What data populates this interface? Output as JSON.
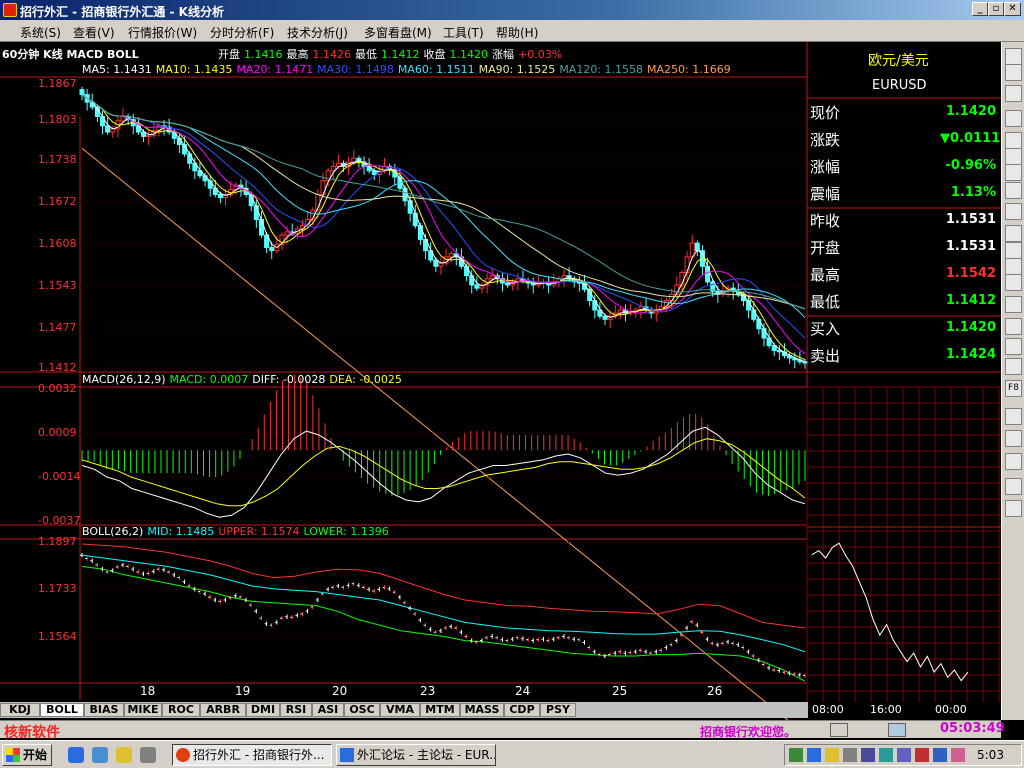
{
  "window": {
    "title": "招行外汇 - 招商银行外汇通 - K线分析"
  },
  "menu": [
    "系统(S)",
    "查看(V)",
    "行情报价(W)",
    "分时分析(F)",
    "技术分析(J)",
    "多窗看盘(M)",
    "工具(T)",
    "帮助(H)"
  ],
  "header": {
    "name": "60分钟 K线 MACD BOLL",
    "quote": [
      {
        "label": "开盘",
        "value": "1.1416"
      },
      {
        "label": "最高",
        "value": "1.1426"
      },
      {
        "label": "最低",
        "value": "1.1412"
      },
      {
        "label": "收盘",
        "value": "1.1420"
      },
      {
        "label": "涨幅",
        "value": "+0.03%"
      }
    ]
  },
  "ma_line": [
    {
      "t": "MA5: 1.1431",
      "c": "#ffffff"
    },
    {
      "t": "MA10: 1.1435",
      "c": "#ffff00"
    },
    {
      "t": "MA20: 1.1471",
      "c": "#ff00ff"
    },
    {
      "t": "MA30: 1.1498",
      "c": "#2f4fff"
    },
    {
      "t": "MA60: 1.1511",
      "c": "#40e0ff"
    },
    {
      "t": "MA90: 1.1525",
      "c": "#e8e8a0"
    },
    {
      "t": "MA120: 1.1558",
      "c": "#4aa0a0"
    },
    {
      "t": "MA250: 1.1669",
      "c": "#ff9a50"
    }
  ],
  "macd": {
    "label": "MACD(26,12,9)",
    "items": [
      {
        "t": "MACD: 0.0007",
        "c": "#00ff00"
      },
      {
        "t": "DIFF: -0.0028",
        "c": "#ffffff"
      },
      {
        "t": "DEA: -0.0025",
        "c": "#ffff00"
      }
    ]
  },
  "boll": {
    "label": "BOLL(26,2)",
    "items": [
      {
        "t": "MID: 1.1485",
        "c": "#00ffff"
      },
      {
        "t": "UPPER: 1.1574",
        "c": "#ff3030"
      },
      {
        "t": "LOWER: 1.1396",
        "c": "#00ff00"
      }
    ]
  },
  "main_axis": [
    "1.1867",
    "1.1803",
    "1.1738",
    "1.1672",
    "1.1608",
    "1.1543",
    "1.1477",
    "1.1412"
  ],
  "macd_axis": [
    "0.0032",
    "0.0009",
    "-0.0014",
    "-0.0037"
  ],
  "boll_axis": [
    "1.1897",
    "1.1733",
    "1.1564"
  ],
  "date_labels": [
    "18",
    "19",
    "20",
    "23",
    "24",
    "25",
    "26"
  ],
  "tabs": [
    "KDJ",
    "BOLL",
    "BIAS",
    "MIKE",
    "ROC",
    "ARBR",
    "DMI",
    "RSI",
    "ASI",
    "OSC",
    "VMA",
    "MTM",
    "MASS",
    "CDP",
    "PSY"
  ],
  "active_tab": "BOLL",
  "panel": {
    "pair_cn": "欧元/美元",
    "pair": "EURUSD",
    "rows": [
      {
        "label": "现价",
        "value": "1.1420",
        "color": "#00ff00"
      },
      {
        "label": "涨跌",
        "value": "▼0.0111",
        "color": "#00ff00"
      },
      {
        "label": "涨幅",
        "value": "-0.96%",
        "color": "#00ff00"
      },
      {
        "label": "震幅",
        "value": "1.13%",
        "color": "#00ff00"
      },
      {
        "label": "昨收",
        "value": "1.1531",
        "color": "#ffffff"
      },
      {
        "label": "开盘",
        "value": "1.1531",
        "color": "#ffffff"
      },
      {
        "label": "最高",
        "value": "1.1542",
        "color": "#ff3030"
      },
      {
        "label": "最低",
        "value": "1.1412",
        "color": "#00ff00"
      },
      {
        "label": "买入",
        "value": "1.1420",
        "color": "#00ff00"
      },
      {
        "label": "卖出",
        "value": "1.1424",
        "color": "#00ff00"
      }
    ],
    "time_axis": [
      "08:00",
      "16:00",
      "00:00"
    ]
  },
  "status": {
    "brand": "核新软件",
    "welcome": "招商银行欢迎您。",
    "clock": "05:03:49"
  },
  "taskbar": {
    "start": "开始",
    "tasks": [
      "招行外汇 - 招商银行外...",
      "外汇论坛 - 主论坛 - EUR..."
    ],
    "time": "5:03"
  },
  "chart_data": [
    {
      "type": "candlestick",
      "title": "60分钟 K线",
      "x_ticks": [
        "18",
        "19",
        "20",
        "23",
        "24",
        "25",
        "26"
      ],
      "ylim": [
        1.1412,
        1.1867
      ],
      "close": [
        1.185,
        1.1838,
        1.183,
        1.1815,
        1.18,
        1.179,
        1.1795,
        1.1808,
        1.1815,
        1.181,
        1.18,
        1.179,
        1.1783,
        1.1785,
        1.1792,
        1.18,
        1.1798,
        1.179,
        1.178,
        1.177,
        1.1755,
        1.174,
        1.1728,
        1.172,
        1.1712,
        1.17,
        1.169,
        1.1685,
        1.169,
        1.1698,
        1.1705,
        1.17,
        1.169,
        1.1672,
        1.165,
        1.1625,
        1.1605,
        1.16,
        1.161,
        1.1625,
        1.163,
        1.1628,
        1.1635,
        1.164,
        1.165,
        1.1665,
        1.169,
        1.1712,
        1.1728,
        1.1735,
        1.174,
        1.1735,
        1.1742,
        1.1748,
        1.1742,
        1.1735,
        1.1728,
        1.1722,
        1.1728,
        1.1735,
        1.173,
        1.1718,
        1.17,
        1.168,
        1.166,
        1.164,
        1.1618,
        1.16,
        1.1585,
        1.1575,
        1.158,
        1.159,
        1.1595,
        1.159,
        1.1575,
        1.156,
        1.1545,
        1.154,
        1.1545,
        1.1555,
        1.156,
        1.1555,
        1.1548,
        1.1545,
        1.155,
        1.1555,
        1.1552,
        1.1548,
        1.1545,
        1.1548,
        1.155,
        1.1545,
        1.155,
        1.1555,
        1.156,
        1.1555,
        1.155,
        1.1548,
        1.1538,
        1.152,
        1.1505,
        1.1495,
        1.149,
        1.1495,
        1.15,
        1.1505,
        1.15,
        1.1502,
        1.1505,
        1.151,
        1.1505,
        1.15,
        1.1505,
        1.151,
        1.152,
        1.153,
        1.1545,
        1.1565,
        1.159,
        1.1612,
        1.16,
        1.1575,
        1.155,
        1.1535,
        1.153,
        1.1535,
        1.154,
        1.1535,
        1.153,
        1.152,
        1.1505,
        1.149,
        1.1475,
        1.146,
        1.1448,
        1.144,
        1.1438,
        1.1432,
        1.1428,
        1.1425,
        1.1422,
        1.142
      ]
    },
    {
      "type": "line+bar",
      "title": "MACD(26,12,9)",
      "x_ticks": [
        "18",
        "19",
        "20",
        "23",
        "24",
        "25",
        "26"
      ],
      "ylim": [
        -0.0037,
        0.0032
      ],
      "diff": [
        -0.0008,
        -0.001,
        -0.0014,
        -0.0016,
        -0.002,
        -0.0022,
        -0.0024,
        -0.0026,
        -0.0028,
        -0.003,
        -0.0033,
        -0.0035,
        -0.0034,
        -0.003,
        -0.0022,
        -0.0012,
        -0.0002,
        0.0006,
        0.001,
        0.0008,
        0.0004,
        -0.0001,
        -0.0006,
        -0.0012,
        -0.0018,
        -0.0023,
        -0.0026,
        -0.0027,
        -0.0025,
        -0.002,
        -0.0016,
        -0.0012,
        -0.001,
        -0.0008,
        -0.0008,
        -0.0007,
        -0.0006,
        -0.0005,
        -0.0003,
        -0.0002,
        -0.0004,
        -0.0008,
        -0.0012,
        -0.0013,
        -0.0012,
        -0.001,
        -0.0006,
        -0.0002,
        0.0004,
        0.001,
        0.0012,
        0.0008,
        0.0002,
        -0.0004,
        -0.0012,
        -0.0018,
        -0.0022,
        -0.0026,
        -0.0028
      ],
      "dea": [
        -0.0005,
        -0.0007,
        -0.0009,
        -0.0011,
        -0.0014,
        -0.0016,
        -0.0018,
        -0.002,
        -0.0022,
        -0.0024,
        -0.0026,
        -0.0028,
        -0.0029,
        -0.0029,
        -0.0027,
        -0.0024,
        -0.002,
        -0.0014,
        -0.0008,
        -0.0003,
        0.0001,
        0.0002,
        0.0,
        -0.0003,
        -0.0007,
        -0.0011,
        -0.0015,
        -0.0018,
        -0.002,
        -0.002,
        -0.0019,
        -0.0017,
        -0.0015,
        -0.0013,
        -0.0012,
        -0.0011,
        -0.001,
        -0.0009,
        -0.0007,
        -0.0006,
        -0.0006,
        -0.0007,
        -0.0008,
        -0.0009,
        -0.001,
        -0.001,
        -0.0009,
        -0.0007,
        -0.0004,
        0.0,
        0.0004,
        0.0006,
        0.0005,
        0.0003,
        -0.0001,
        -0.0006,
        -0.0011,
        -0.0016,
        -0.002,
        -0.0025
      ]
    },
    {
      "type": "line",
      "title": "BOLL(26,2)",
      "x_ticks": [
        "18",
        "19",
        "20",
        "23",
        "24",
        "25",
        "26"
      ],
      "ylim": [
        1.1397,
        1.1897
      ],
      "upper": [
        1.189,
        1.1885,
        1.188,
        1.187,
        1.186,
        1.1845,
        1.183,
        1.181,
        1.1785,
        1.177,
        1.1775,
        1.179,
        1.18,
        1.1798,
        1.1785,
        1.176,
        1.1735,
        1.171,
        1.169,
        1.168,
        1.167,
        1.1668,
        1.166,
        1.1655,
        1.165,
        1.1648,
        1.1645,
        1.164,
        1.1655,
        1.1675,
        1.167,
        1.164,
        1.161,
        1.16,
        1.159
      ],
      "mid": [
        1.185,
        1.184,
        1.183,
        1.182,
        1.181,
        1.1795,
        1.178,
        1.176,
        1.174,
        1.173,
        1.1725,
        1.172,
        1.171,
        1.17,
        1.169,
        1.167,
        1.165,
        1.163,
        1.161,
        1.16,
        1.159,
        1.1585,
        1.158,
        1.1578,
        1.1575,
        1.157,
        1.1568,
        1.1568,
        1.1575,
        1.158,
        1.1578,
        1.1565,
        1.1548,
        1.153,
        1.1505
      ],
      "lower": [
        1.181,
        1.18,
        1.178,
        1.1765,
        1.175,
        1.1735,
        1.172,
        1.17,
        1.1685,
        1.168,
        1.1675,
        1.167,
        1.165,
        1.162,
        1.16,
        1.158,
        1.157,
        1.156,
        1.1545,
        1.154,
        1.153,
        1.152,
        1.151,
        1.15,
        1.1495,
        1.149,
        1.149,
        1.1495,
        1.1495,
        1.15,
        1.1495,
        1.149,
        1.147,
        1.144,
        1.14
      ]
    },
    {
      "type": "line",
      "title": "EURUSD 分时",
      "x_ticks": [
        "08:00",
        "16:00",
        "00:00"
      ],
      "values": [
        1.1531,
        1.1535,
        1.1528,
        1.1538,
        1.1542,
        1.153,
        1.152,
        1.1505,
        1.149,
        1.147,
        1.1455,
        1.1465,
        1.145,
        1.144,
        1.143,
        1.1438,
        1.1425,
        1.1435,
        1.142,
        1.1428,
        1.1415,
        1.1422,
        1.1412,
        1.142
      ]
    }
  ]
}
